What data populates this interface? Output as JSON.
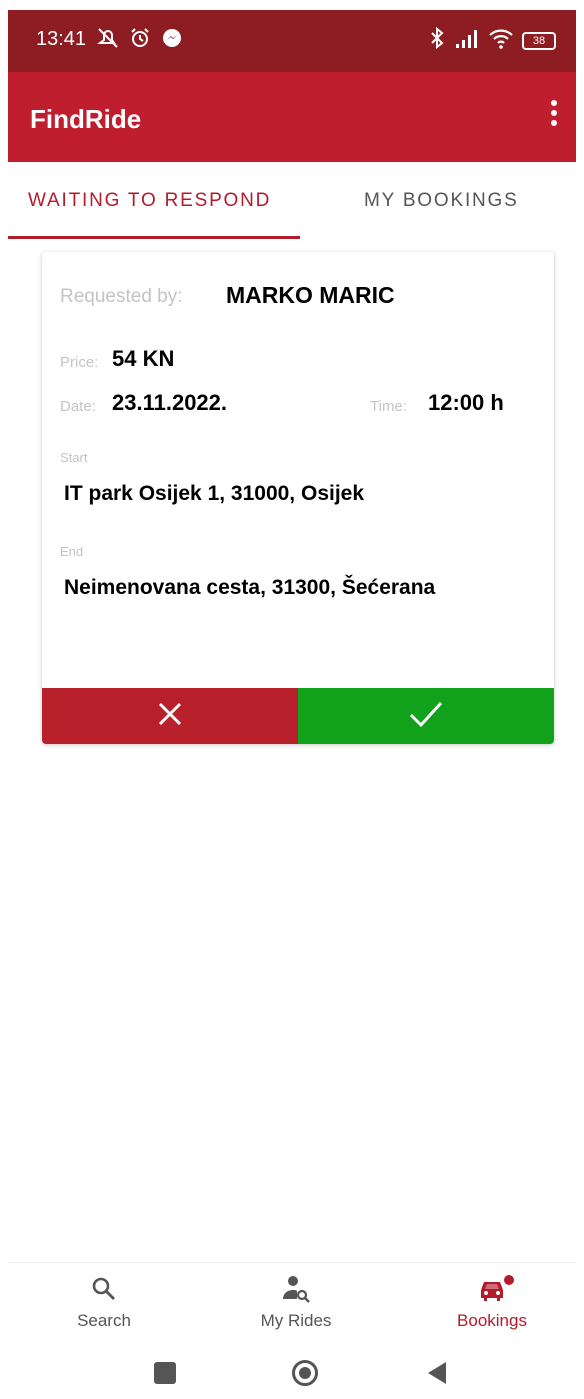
{
  "status_bar": {
    "time": "13:41",
    "battery": "38",
    "icons_left": [
      "mute-icon",
      "alarm-icon",
      "messenger-icon"
    ],
    "icons_right": [
      "bluetooth-icon",
      "signal-icon",
      "wifi-icon",
      "battery-icon"
    ]
  },
  "app_bar": {
    "title": "FindRide",
    "menu_icon": "more-vertical-icon"
  },
  "tabs": [
    {
      "label": "WAITING TO RESPOND",
      "active": true
    },
    {
      "label": "MY BOOKINGS",
      "active": false
    }
  ],
  "booking": {
    "requested_by_label": "Requested by:",
    "requested_by": "MARKO MARIC",
    "price_label": "Price:",
    "price": "54 KN",
    "date_label": "Date:",
    "date": "23.11.2022.",
    "time_label": "Time:",
    "time": "12:00 h",
    "start_label": "Start",
    "start": "IT park Osijek 1, 31000, Osijek",
    "end_label": "End",
    "end": "Neimenovana cesta, 31300, Šećerana",
    "reject_icon": "close-icon",
    "accept_icon": "check-icon"
  },
  "bottom_nav": [
    {
      "label": "Search",
      "icon": "search-icon",
      "active": false
    },
    {
      "label": "My Rides",
      "icon": "person-search-icon",
      "active": false
    },
    {
      "label": "Bookings",
      "icon": "car-icon",
      "active": true,
      "badge": true
    }
  ],
  "colors": {
    "status_bar": "#8e1c23",
    "primary": "#be1e2d",
    "accent_text": "#b31b2b",
    "reject": "#b8202c",
    "accept": "#12a11b"
  }
}
